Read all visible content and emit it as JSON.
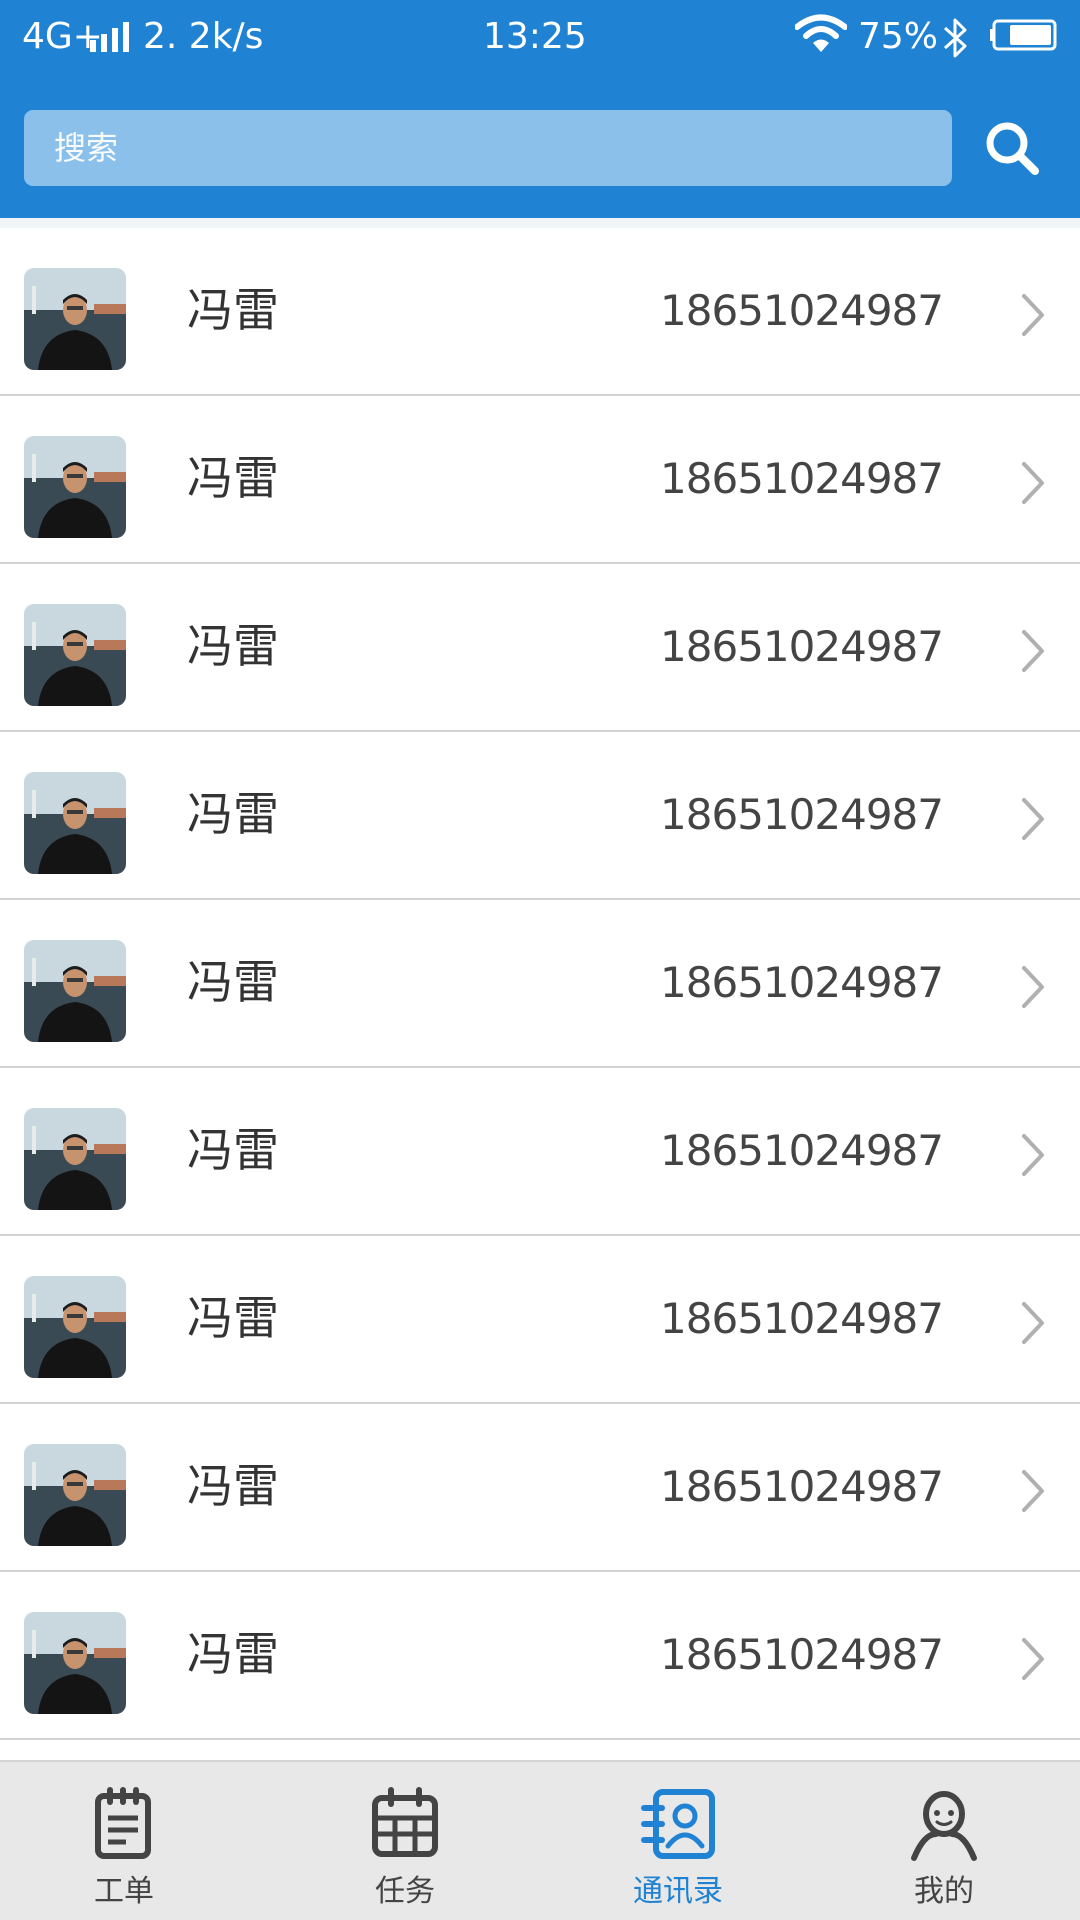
{
  "status_bar": {
    "network": "4G+",
    "speed": "2. 2k/s",
    "time": "13:25",
    "battery": "75%"
  },
  "search": {
    "placeholder": "搜索",
    "icon": "search-icon"
  },
  "contacts": [
    {
      "name": "冯雷",
      "phone": "18651024987"
    },
    {
      "name": "冯雷",
      "phone": "18651024987"
    },
    {
      "name": "冯雷",
      "phone": "18651024987"
    },
    {
      "name": "冯雷",
      "phone": "18651024987"
    },
    {
      "name": "冯雷",
      "phone": "18651024987"
    },
    {
      "name": "冯雷",
      "phone": "18651024987"
    },
    {
      "name": "冯雷",
      "phone": "18651024987"
    },
    {
      "name": "冯雷",
      "phone": "18651024987"
    },
    {
      "name": "冯雷",
      "phone": "18651024987"
    }
  ],
  "tabs": [
    {
      "label": "工单",
      "icon": "clipboard-icon"
    },
    {
      "label": "任务",
      "icon": "calendar-icon"
    },
    {
      "label": "通讯录",
      "icon": "contacts-icon",
      "active": true
    },
    {
      "label": "我的",
      "icon": "user-icon"
    }
  ],
  "colors": {
    "brand": "#1f82d2",
    "search_field": "#8bc0ea",
    "active_tab": "#1f82d2",
    "inactive_tab": "#444444"
  }
}
